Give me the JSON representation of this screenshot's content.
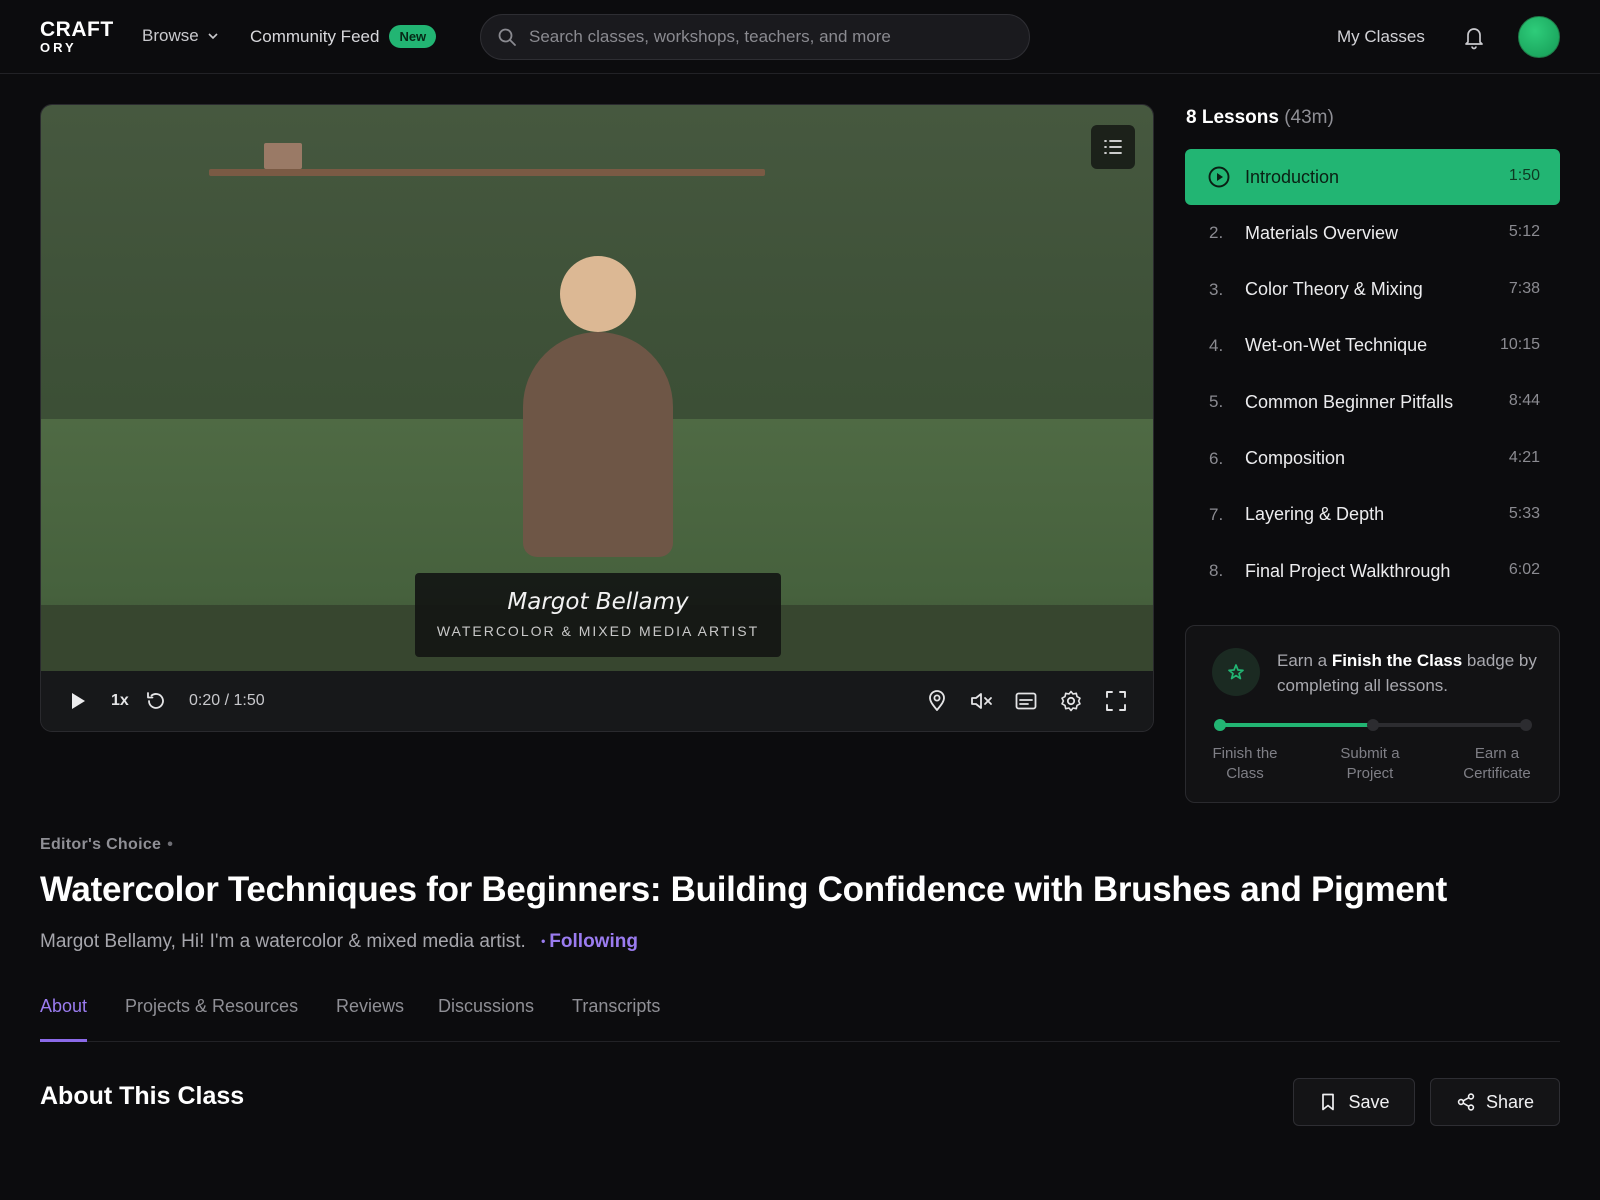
{
  "brand": {
    "line1": "CRAFT",
    "line2": "ORY"
  },
  "nav": {
    "browse": "Browse",
    "community_feed": "Community Feed",
    "new_badge": "New",
    "search_placeholder": "Search classes, workshops, teachers, and more",
    "my_classes": "My Classes"
  },
  "player": {
    "presenter_name": "Margot Bellamy",
    "presenter_role": "WATERCOLOR & MIXED MEDIA ARTIST",
    "speed": "1x",
    "time": "0:20 / 1:50",
    "icons": [
      "play-icon",
      "rewind-icon",
      "location-pin-icon",
      "mute-icon",
      "captions-icon",
      "settings-icon",
      "fullscreen-icon",
      "playlist-icon"
    ]
  },
  "lessons": {
    "count_label": "8 Lessons",
    "total_duration": "(43m)",
    "items": [
      {
        "num": "",
        "title": "Introduction",
        "duration": "1:50",
        "active": true
      },
      {
        "num": "2.",
        "title": "Materials Overview",
        "duration": "5:12"
      },
      {
        "num": "3.",
        "title": "Color Theory & Mixing",
        "duration": "7:38"
      },
      {
        "num": "4.",
        "title": "Wet-on-Wet Technique",
        "duration": "10:15"
      },
      {
        "num": "5.",
        "title": "Common Beginner Pitfalls",
        "duration": "8:44"
      },
      {
        "num": "6.",
        "title": "Composition",
        "duration": "4:21"
      },
      {
        "num": "7.",
        "title": "Layering & Depth",
        "duration": "5:33"
      },
      {
        "num": "8.",
        "title": "Final Project Walkthrough",
        "duration": "6:02"
      }
    ]
  },
  "badge": {
    "text_before": "Earn a ",
    "badge_name": "Finish the Class",
    "text_after": " badge by completing all lessons.",
    "progress_fraction": 0.5,
    "steps": [
      {
        "line1": "Finish the",
        "line2": "Class"
      },
      {
        "line1": "Submit a",
        "line2": "Project"
      },
      {
        "line1": "Earn a",
        "line2": "Certificate"
      }
    ]
  },
  "class": {
    "eyebrow": "Editor's Choice",
    "title": "Watercolor Techniques for Beginners: Building Confidence with Brushes and Pigment",
    "teacher_line": "Margot Bellamy, Hi! I'm a watercolor & mixed media artist.",
    "following": "Following"
  },
  "tabs": [
    "About",
    "Projects & Resources",
    "Reviews",
    "Discussions",
    "Transcripts"
  ],
  "about": {
    "heading": "About This Class",
    "save": "Save",
    "share": "Share"
  },
  "colors": {
    "accent_green": "#22b573",
    "accent_purple": "#9b7cf0",
    "background": "#0c0c0e"
  }
}
